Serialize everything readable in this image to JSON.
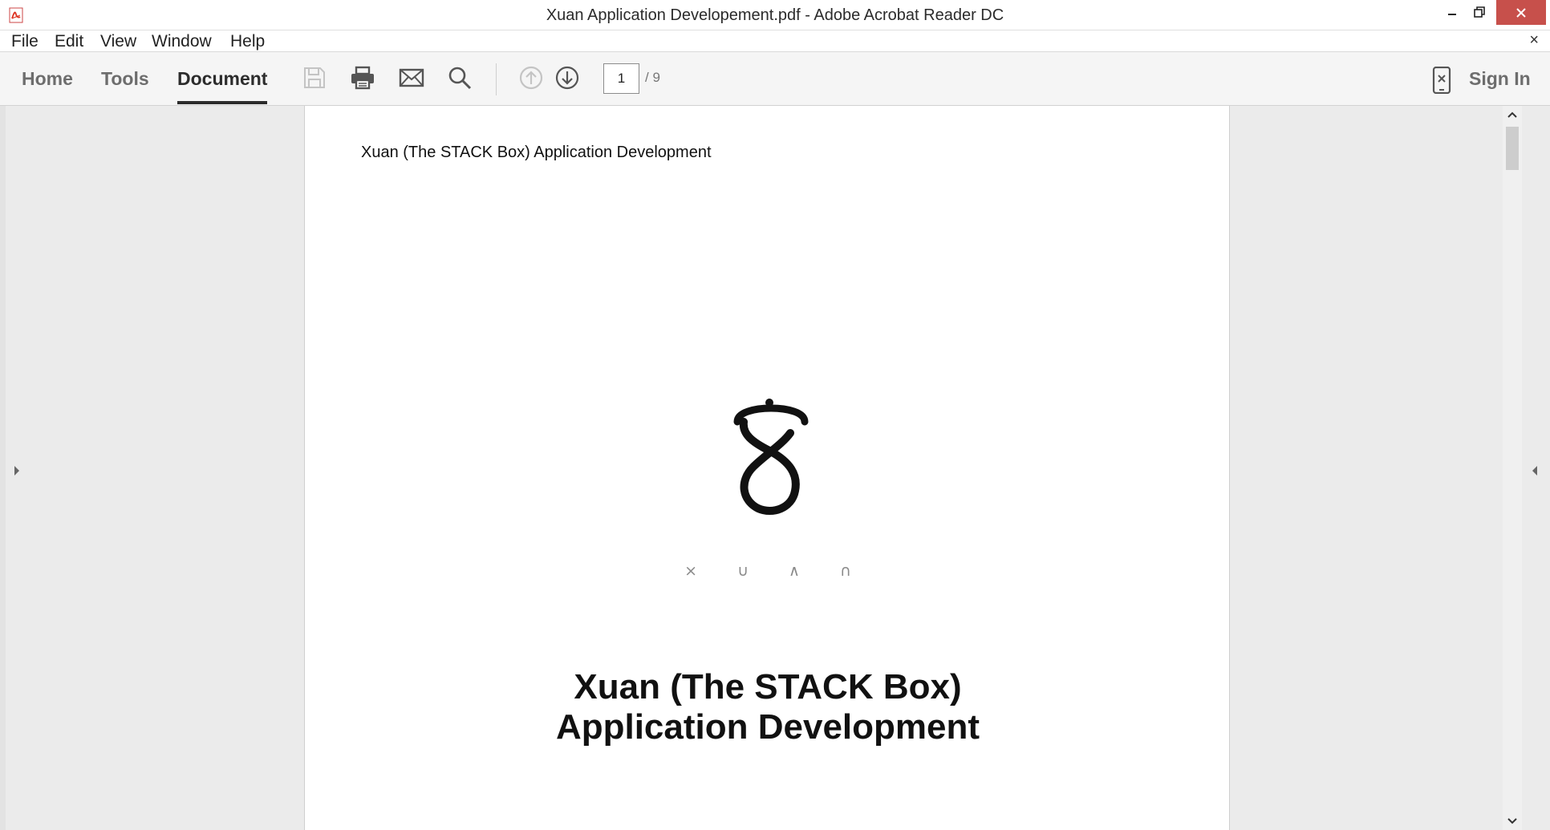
{
  "window": {
    "title": "Xuan Application Developement.pdf - Adobe Acrobat Reader DC",
    "minimize_icon": "minimize-icon",
    "restore_icon": "restore-icon",
    "close_icon": "close-icon",
    "close_color": "#c7504b"
  },
  "menu": {
    "items": [
      "File",
      "Edit",
      "View",
      "Window",
      "Help"
    ],
    "close_document": "×"
  },
  "toolbar": {
    "tabs": [
      "Home",
      "Tools",
      "Document"
    ],
    "active_tab": "Document",
    "tools": [
      "save-icon",
      "print-icon",
      "email-icon",
      "search-icon",
      "page-up-icon",
      "page-down-icon"
    ],
    "page_current": "1",
    "page_total": "/ 9",
    "sign_in": "Sign In"
  },
  "document": {
    "header": "Xuan (The STACK Box) Application Development",
    "logo_letters": "× ∪ ∧ ∩",
    "title_line1": "Xuan (The STACK Box)",
    "title_line2": "Application Development"
  }
}
